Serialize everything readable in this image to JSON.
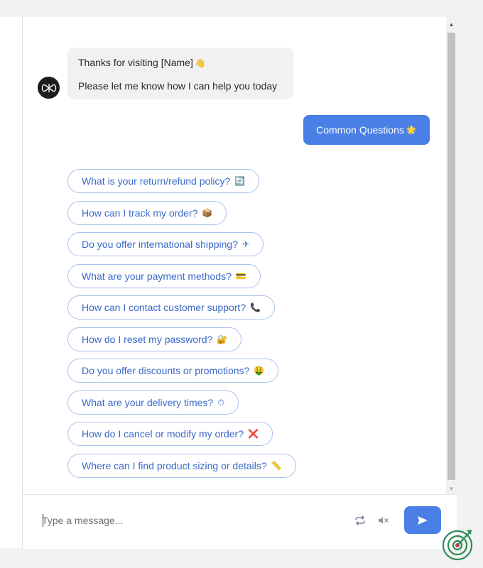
{
  "chat": {
    "bot_message": {
      "line1": "Thanks for visiting [Name]",
      "line1_emoji": "👋",
      "line2": "Please let me know how I can help you today"
    },
    "user_message": {
      "text": "Common Questions",
      "emoji": "🌟"
    },
    "quick_replies": [
      {
        "label": "What is your return/refund policy?",
        "icon": "🔄"
      },
      {
        "label": "How can I track my order?",
        "icon": "📦"
      },
      {
        "label": "Do you offer international shipping?",
        "icon": "✈"
      },
      {
        "label": "What are your payment methods?",
        "icon": "💳"
      },
      {
        "label": "How can I contact customer support?",
        "icon": "📞"
      },
      {
        "label": "How do I reset my password?",
        "icon": "🔐"
      },
      {
        "label": "Do you offer discounts or promotions?",
        "icon": "🤑"
      },
      {
        "label": "What are your delivery times?",
        "icon": "⏱"
      },
      {
        "label": "How do I cancel or modify my order?",
        "icon": "❌"
      },
      {
        "label": "Where can I find product sizing or details?",
        "icon": "📏"
      }
    ]
  },
  "composer": {
    "placeholder": "Type a message...",
    "value": ""
  },
  "icons": {
    "avatar": "bot-avatar-icon",
    "refresh": "refresh-icon",
    "mute": "speaker-mute-icon",
    "send": "send-icon",
    "widget": "target-logo-icon"
  },
  "colors": {
    "accent": "#4a7fe5",
    "chip_text": "#3a69c9",
    "chip_border": "#a9c0ec",
    "bot_bubble": "#f1f1f1",
    "widget_logo": "#2e8b57"
  }
}
